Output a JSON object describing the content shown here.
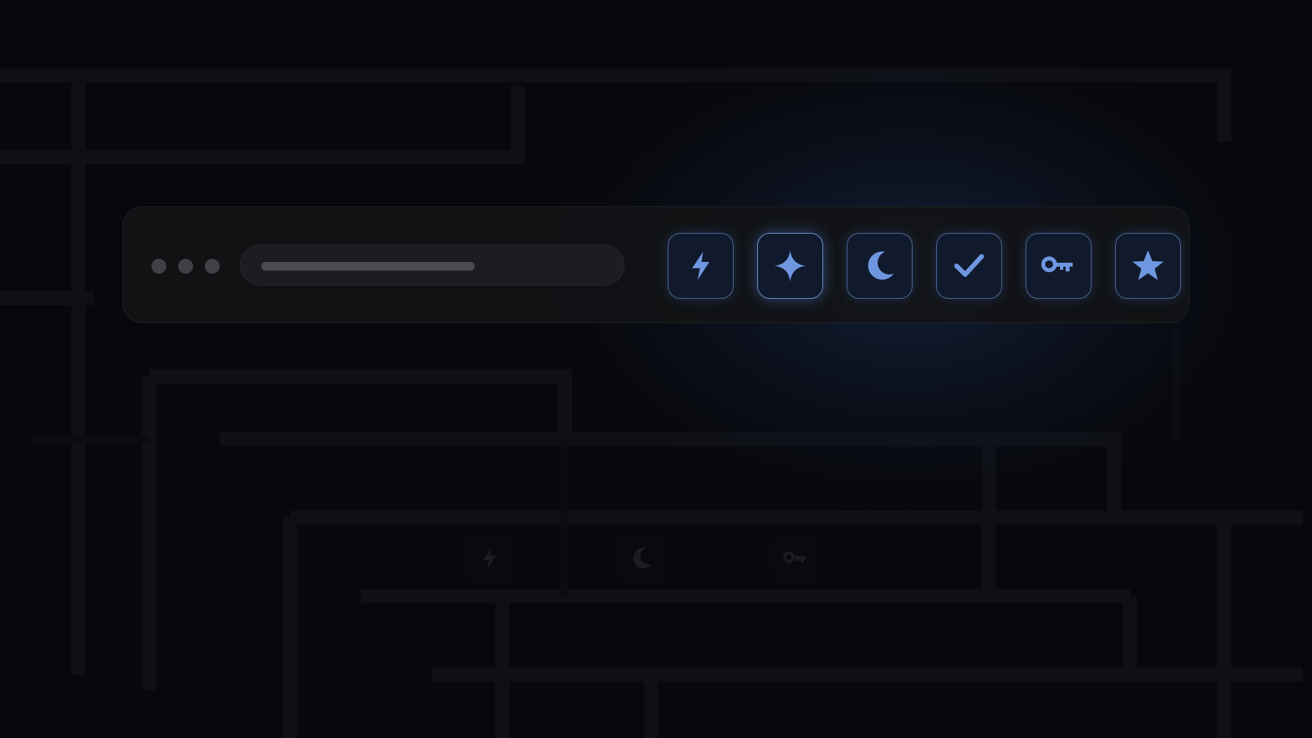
{
  "colors": {
    "background": "#07080b",
    "toolbar_bg": "#121316",
    "icon_accent": "#6f96e0",
    "icon_border": "#4a6591",
    "glow": "#1c345c"
  },
  "toolbar": {
    "window_controls": [
      "dot",
      "dot",
      "dot"
    ],
    "address_bar": {
      "load_progress": 0.55
    },
    "icon_buttons": [
      {
        "icon": "lightning-icon",
        "active": false
      },
      {
        "icon": "sparkle-icon",
        "active": true
      },
      {
        "icon": "moon-icon",
        "active": false
      },
      {
        "icon": "checkmark-icon",
        "active": false
      },
      {
        "icon": "key-icon",
        "active": false
      },
      {
        "icon": "star-icon",
        "active": false
      }
    ]
  },
  "reflection_icons": [
    "lightning-icon",
    "moon-icon",
    "key-icon"
  ]
}
